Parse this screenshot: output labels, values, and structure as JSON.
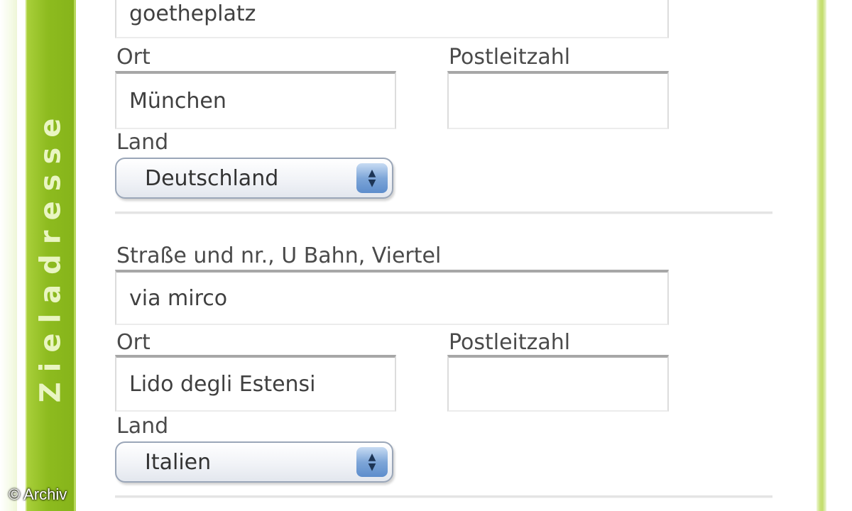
{
  "sidebar": {
    "label": "Zieladresse"
  },
  "address_block_1": {
    "street_value": "goetheplatz",
    "city_label": "Ort",
    "city_value": "München",
    "postal_label": "Postleitzahl",
    "postal_value": "",
    "country_label": "Land",
    "country_value": "Deutschland"
  },
  "address_block_2": {
    "street_label": "Straße und nr., U Bahn, Viertel",
    "street_value": "via mirco",
    "city_label": "Ort",
    "city_value": "Lido degli Estensi",
    "postal_label": "Postleitzahl",
    "postal_value": "",
    "country_label": "Land",
    "country_value": "Italien"
  },
  "watermark": {
    "credit": "© Archiv"
  },
  "colors": {
    "sidebar_green": "#8dbb1f",
    "panel_border": "#c2dd6c",
    "select_stepper_blue": "#7ea6d8"
  },
  "icons": {
    "select_arrows": "up-down-chevron-icon"
  }
}
